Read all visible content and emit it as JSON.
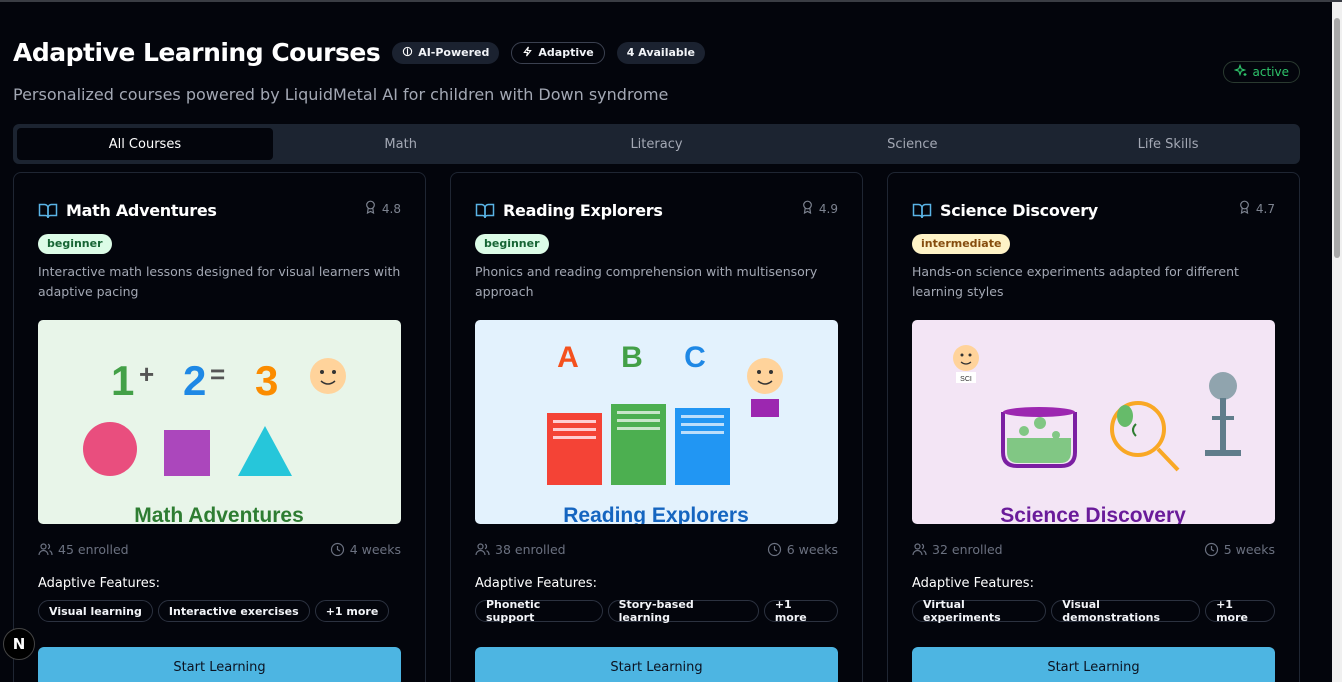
{
  "header": {
    "title": "Adaptive Learning Courses",
    "badges": [
      "AI-Powered",
      "Adaptive",
      "4 Available"
    ],
    "subtitle": "Personalized courses powered by LiquidMetal AI for children with Down syndrome",
    "status": "active"
  },
  "tabs": [
    "All Courses",
    "Math",
    "Literacy",
    "Science",
    "Life Skills"
  ],
  "active_tab": "All Courses",
  "colors": {
    "accent_button": "#4db5e2",
    "status_green": "#2ec36a",
    "beginner_bg": "#dcfce7",
    "intermediate_bg": "#fef3c7"
  },
  "courses": [
    {
      "title": "Math Adventures",
      "rating": "4.8",
      "level": "beginner",
      "description": "Interactive math lessons designed for visual learners with adaptive pacing",
      "image_caption": "Math Adventures",
      "image_text": [
        "1",
        "+",
        "2",
        "=",
        "3"
      ],
      "enrolled": "45 enrolled",
      "duration": "4 weeks",
      "features_label": "Adaptive Features:",
      "features": [
        "Visual learning",
        "Interactive exercises",
        "+1 more"
      ],
      "button": "Start Learning"
    },
    {
      "title": "Reading Explorers",
      "rating": "4.9",
      "level": "beginner",
      "description": "Phonics and reading comprehension with multisensory approach",
      "image_caption": "Reading Explorers",
      "image_text": [
        "A",
        "B",
        "C"
      ],
      "enrolled": "38 enrolled",
      "duration": "6 weeks",
      "features_label": "Adaptive Features:",
      "features": [
        "Phonetic support",
        "Story-based learning",
        "+1 more"
      ],
      "button": "Start Learning"
    },
    {
      "title": "Science Discovery",
      "rating": "4.7",
      "level": "intermediate",
      "description": "Hands-on science experiments adapted for different learning styles",
      "image_caption": "Science Discovery",
      "image_text": [
        "SCI"
      ],
      "enrolled": "32 enrolled",
      "duration": "5 weeks",
      "features_label": "Adaptive Features:",
      "features": [
        "Virtual experiments",
        "Visual demonstrations",
        "+1 more"
      ],
      "button": "Start Learning"
    }
  ],
  "dev_badge": "N"
}
